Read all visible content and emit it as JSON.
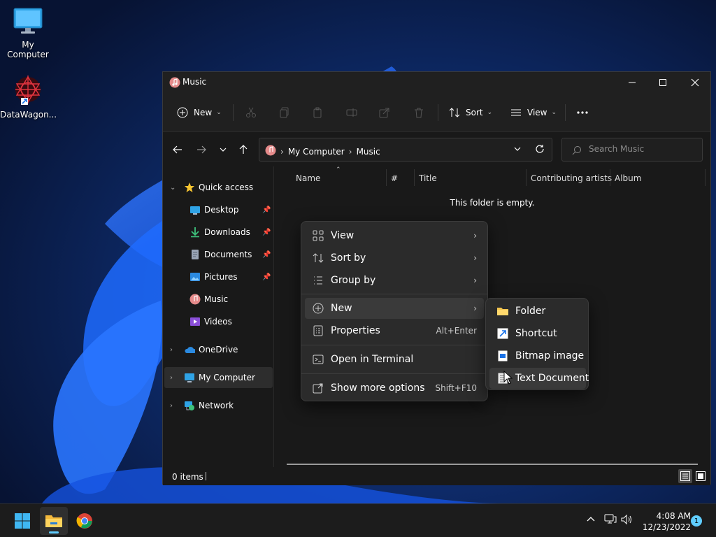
{
  "desktop": {
    "icons": [
      {
        "label": "My Computer",
        "icon": "monitor-icon"
      },
      {
        "label": "DataWagon...",
        "icon": "datawagon-app-icon"
      }
    ]
  },
  "window": {
    "title": "Music",
    "controls": {
      "minimize": "minimize-icon",
      "maximize": "maximize-icon",
      "close": "close-icon"
    }
  },
  "command_bar": {
    "new_label": "New",
    "sort_label": "Sort",
    "view_label": "View",
    "disabled_icons": [
      "cut-icon",
      "copy-icon",
      "paste-icon",
      "rename-icon",
      "share-icon",
      "delete-icon"
    ],
    "more_icon": "more-icon"
  },
  "address_bar": {
    "crumbs": [
      "My Computer",
      "Music"
    ]
  },
  "search": {
    "placeholder": "Search Music"
  },
  "sidebar": {
    "quick_access": "Quick access",
    "items": [
      {
        "label": "Desktop",
        "icon": "desktop-folder-icon",
        "pinned": true
      },
      {
        "label": "Downloads",
        "icon": "downloads-icon",
        "pinned": true
      },
      {
        "label": "Documents",
        "icon": "documents-icon",
        "pinned": true
      },
      {
        "label": "Pictures",
        "icon": "pictures-icon",
        "pinned": true
      },
      {
        "label": "Music",
        "icon": "music-icon",
        "pinned": false
      },
      {
        "label": "Videos",
        "icon": "videos-icon",
        "pinned": false
      }
    ],
    "onedrive": "OneDrive",
    "my_computer": "My Computer",
    "network": "Network"
  },
  "columns": [
    "Name",
    "#",
    "Title",
    "Contributing artists",
    "Album"
  ],
  "empty_message": "This folder is empty.",
  "status": {
    "item_count": "0 items"
  },
  "context_menu": {
    "items": [
      {
        "label": "View",
        "icon": "grid-icon"
      },
      {
        "label": "Sort by",
        "icon": "sort-icon"
      },
      {
        "label": "Group by",
        "icon": "group-icon"
      },
      {
        "label": "New",
        "icon": "add-circle-icon"
      },
      {
        "label": "Properties",
        "icon": "properties-icon",
        "shortcut": "Alt+Enter"
      },
      {
        "label": "Open in Terminal",
        "icon": "terminal-icon"
      },
      {
        "label": "Show more options",
        "icon": "more-options-icon",
        "shortcut": "Shift+F10"
      }
    ]
  },
  "submenu": {
    "items": [
      {
        "label": "Folder",
        "icon": "folder-icon"
      },
      {
        "label": "Shortcut",
        "icon": "shortcut-icon"
      },
      {
        "label": "Bitmap image",
        "icon": "bitmap-icon"
      },
      {
        "label": "Text Document",
        "icon": "text-document-icon"
      }
    ]
  },
  "taskbar": {
    "clock_time": "4:08 AM",
    "clock_date": "12/23/2022",
    "notification_count": "1"
  },
  "colors": {
    "accent": "#60cdff",
    "window_bg": "#191919",
    "menu_bg": "#2b2b2b",
    "taskbar_bg": "#1c1c1c"
  }
}
